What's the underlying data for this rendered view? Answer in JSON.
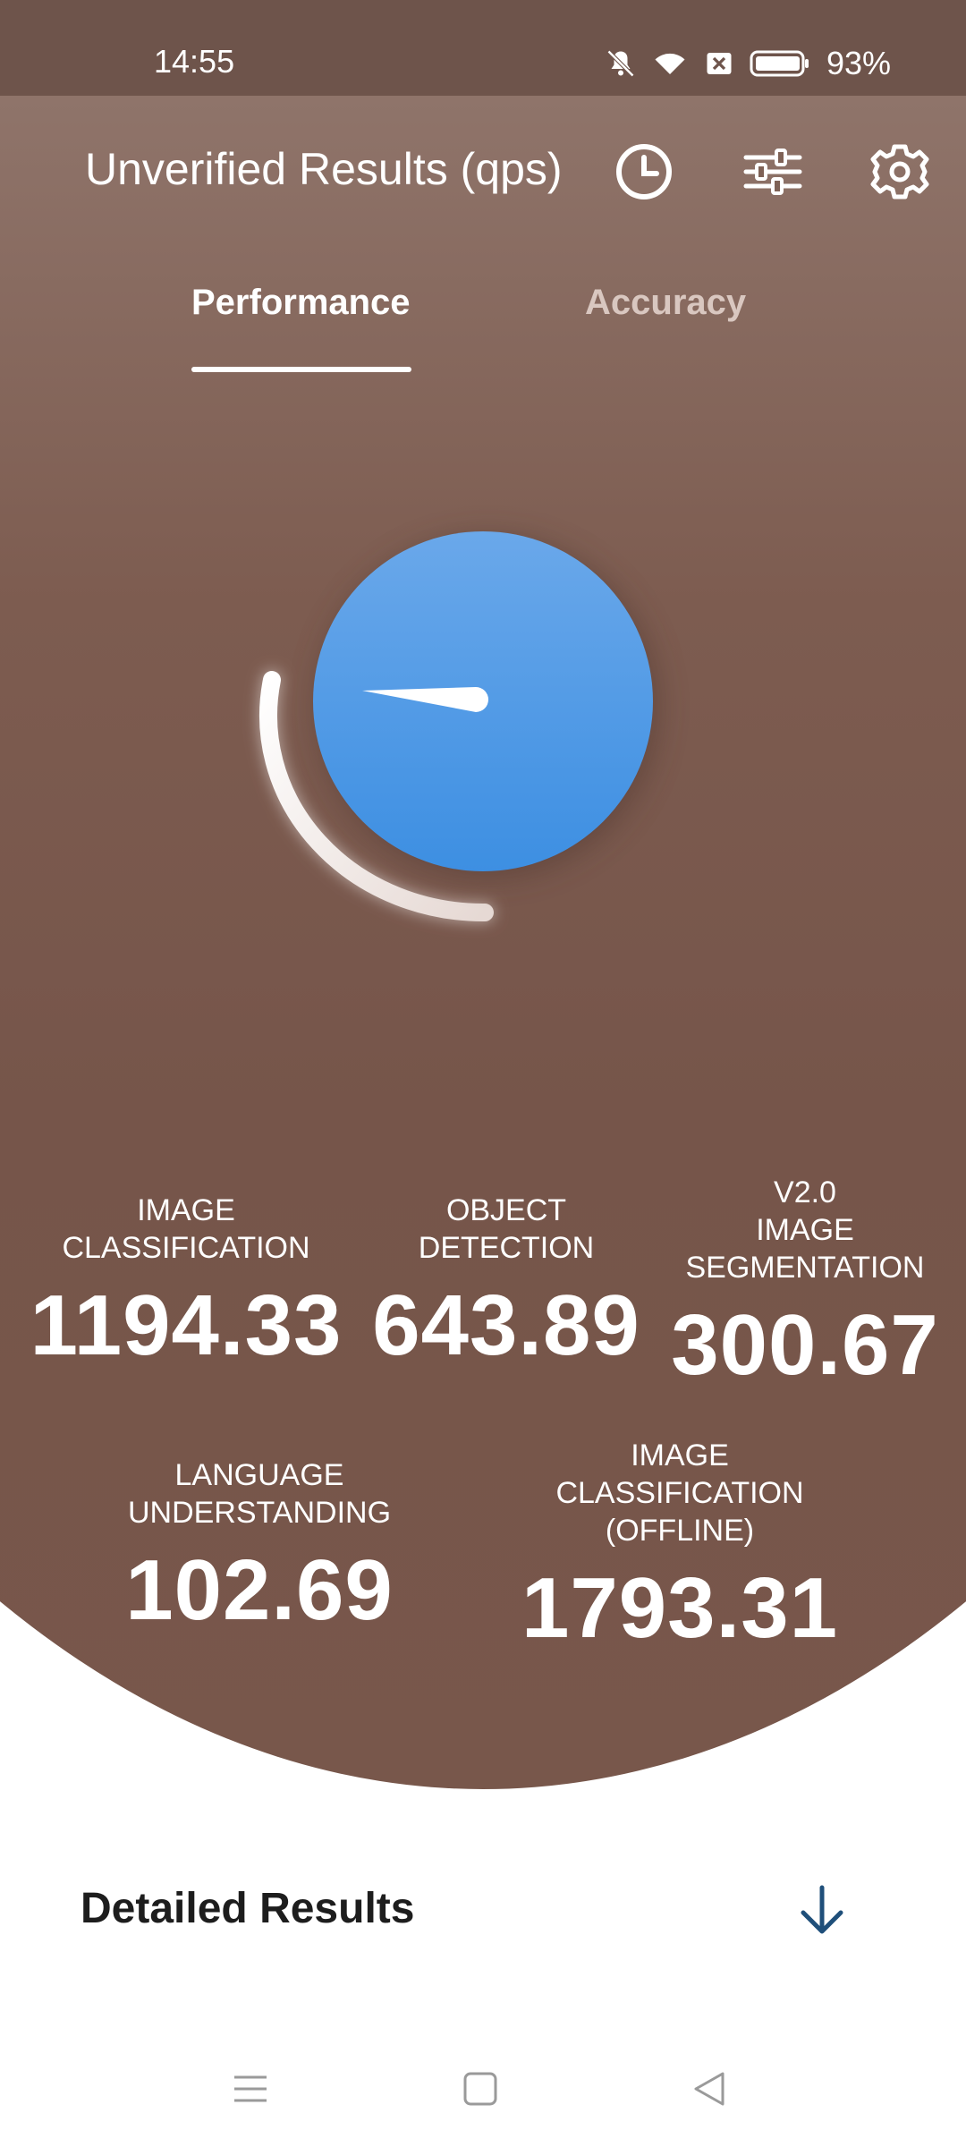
{
  "status_bar": {
    "time": "14:55",
    "battery_percent": "93%",
    "icons": [
      "mute-bell-icon",
      "wifi-icon",
      "sim-off-icon",
      "battery-icon"
    ]
  },
  "header": {
    "title": "Unverified Results (qps)",
    "icons": [
      "history-clock-icon",
      "sliders-icon",
      "settings-gear-icon"
    ]
  },
  "tabs": [
    {
      "label": "Performance",
      "selected": true
    },
    {
      "label": "Accuracy",
      "selected": false
    }
  ],
  "gauge": {
    "icon": "speedometer-gauge"
  },
  "metrics": [
    {
      "label_lines": [
        "IMAGE",
        "CLASSIFICATION"
      ],
      "value": "1194.33"
    },
    {
      "label_lines": [
        "OBJECT",
        "DETECTION"
      ],
      "value": "643.89"
    },
    {
      "label_lines": [
        "V2.0",
        "IMAGE",
        "SEGMENTATION"
      ],
      "value": "300.67"
    },
    {
      "label_lines": [
        "LANGUAGE",
        "UNDERSTANDING"
      ],
      "value": "102.69"
    },
    {
      "label_lines": [
        "IMAGE",
        "CLASSIFICATION",
        "(OFFLINE)"
      ],
      "value": "1793.31"
    }
  ],
  "detailed_results": {
    "title": "Detailed Results"
  },
  "colors": {
    "hero_brown": "#78574b",
    "gauge_blue": "#4a94e6",
    "arrow_blue": "#1f4f7a"
  }
}
